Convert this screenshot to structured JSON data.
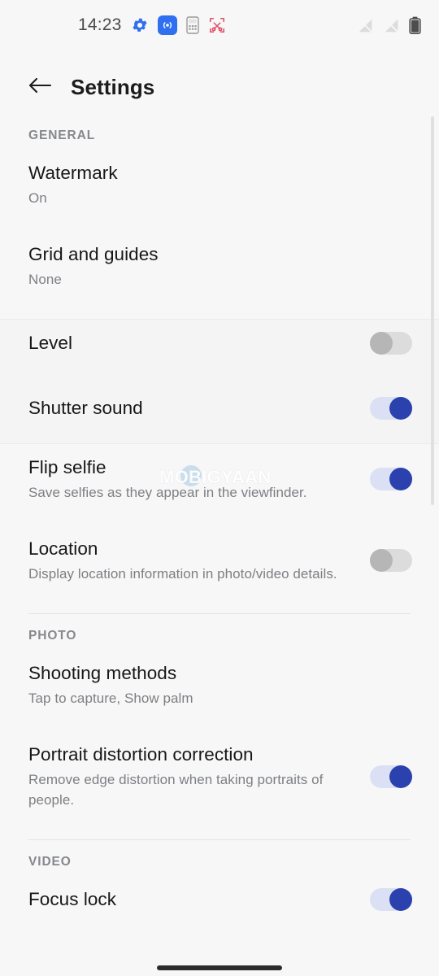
{
  "status_bar": {
    "time": "14:23",
    "left_icons": [
      {
        "name": "gear-icon",
        "color": "#2f6ff0"
      },
      {
        "name": "hotspot-broadcast-icon",
        "color": "#2f6ff0"
      },
      {
        "name": "calculator-icon",
        "color": "#8d8d8d"
      },
      {
        "name": "screenshot-scissors-icon",
        "color": "#e0506a"
      }
    ],
    "right_icons": [
      {
        "name": "signal-sim1-none-icon",
        "color": "#d8d8d8"
      },
      {
        "name": "signal-sim2-none-icon",
        "color": "#d8d8d8"
      },
      {
        "name": "battery-icon",
        "color": "#4d4d4d"
      }
    ]
  },
  "app_bar": {
    "back_icon": "arrow-left-icon",
    "title": "Settings"
  },
  "sections": [
    {
      "header": "GENERAL",
      "rows": [
        {
          "title": "Watermark",
          "subtitle": "On",
          "control": "none"
        },
        {
          "title": "Grid and guides",
          "subtitle": "None",
          "control": "none"
        }
      ]
    },
    {
      "header": "",
      "rows": [
        {
          "title": "Level",
          "subtitle": "",
          "control": "toggle",
          "state": "off"
        },
        {
          "title": "Shutter sound",
          "subtitle": "",
          "control": "toggle",
          "state": "on"
        }
      ]
    },
    {
      "header": "",
      "rows": [
        {
          "title": "Flip selfie",
          "subtitle": "Save selfies as they appear in the viewfinder.",
          "control": "toggle",
          "state": "on"
        },
        {
          "title": "Location",
          "subtitle": "Display location information in photo/video details.",
          "control": "toggle",
          "state": "off"
        }
      ]
    },
    {
      "header": "PHOTO",
      "rows": [
        {
          "title": "Shooting methods",
          "subtitle": "Tap to capture, Show palm",
          "control": "none"
        },
        {
          "title": "Portrait distortion correction",
          "subtitle": "Remove edge distortion when taking portraits of people.",
          "control": "toggle",
          "state": "on"
        }
      ]
    },
    {
      "header": "VIDEO",
      "rows": [
        {
          "title": "Focus lock",
          "subtitle": "",
          "control": "toggle",
          "state": "on"
        }
      ]
    }
  ],
  "watermark": {
    "text": "MOBIGYAAN"
  },
  "colors": {
    "background": "#f7f7f7",
    "toggle_on_thumb": "#2b41ae",
    "toggle_on_track": "#dbe0f4",
    "toggle_off_thumb": "#b6b6b6",
    "toggle_off_track": "#dcdcdc",
    "title_text": "#171717",
    "subtitle_text": "#7d7f83",
    "section_header_text": "#86888c",
    "accent_blue": "#2f6ff0",
    "accent_red": "#e0506a"
  }
}
